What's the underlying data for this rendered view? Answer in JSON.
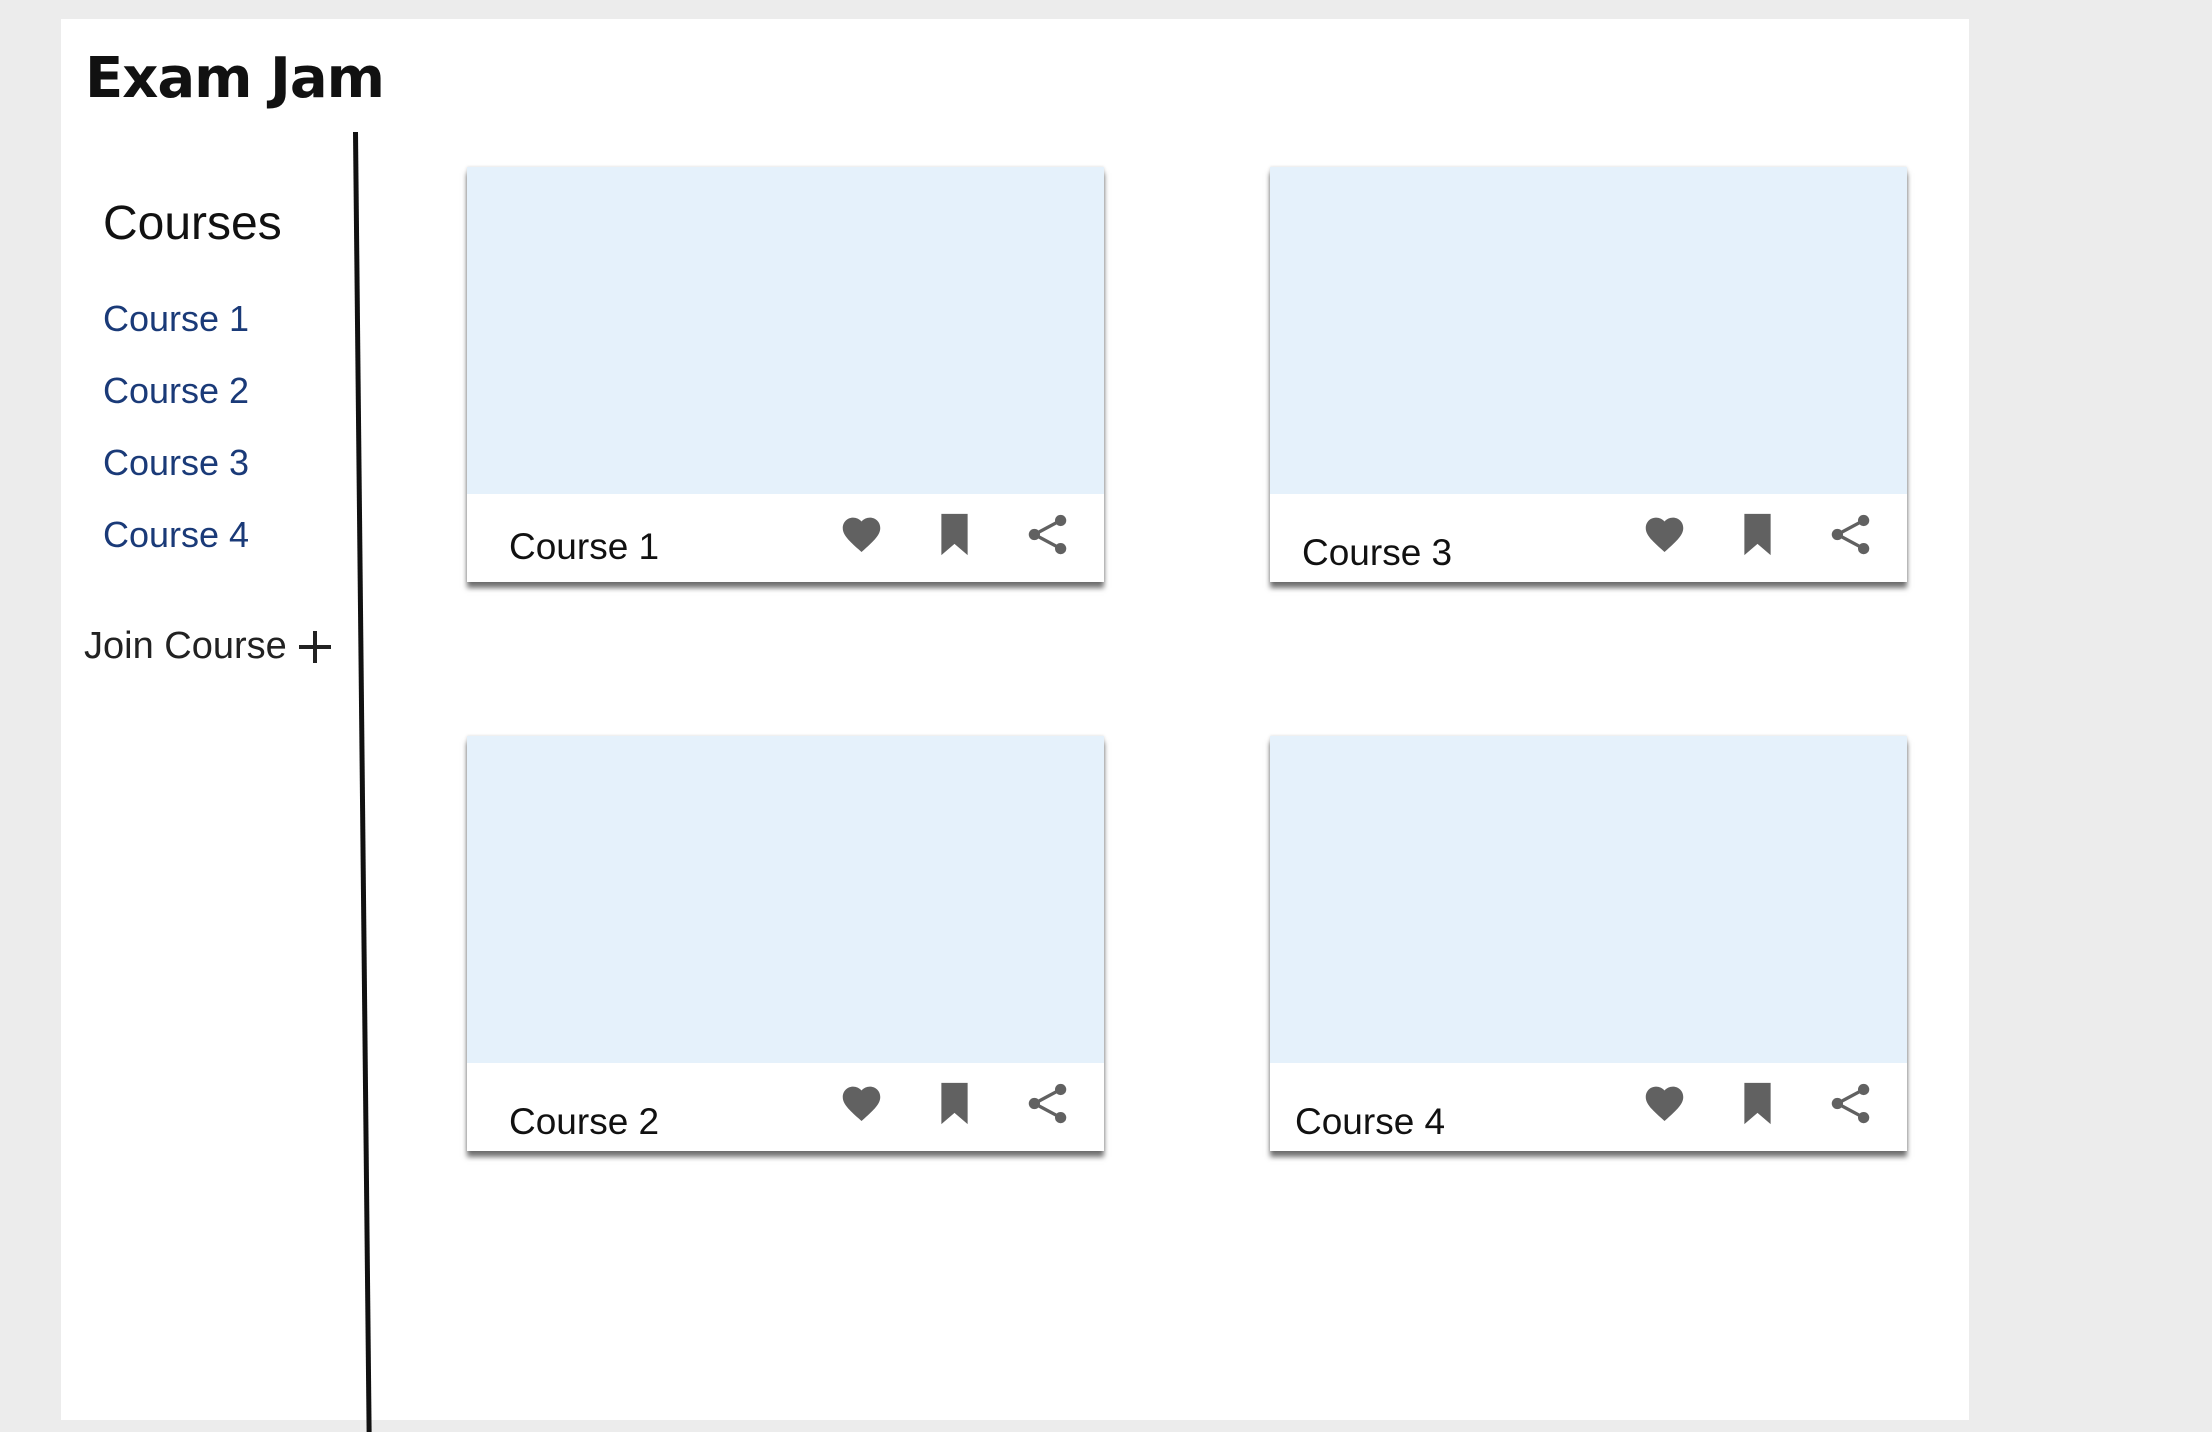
{
  "app": {
    "title": "Exam Jam"
  },
  "sidebar": {
    "heading": "Courses",
    "items": [
      {
        "label": "Course 1"
      },
      {
        "label": "Course 2"
      },
      {
        "label": "Course 3"
      },
      {
        "label": "Course 4"
      }
    ],
    "join_label": "Join Course",
    "join_icon": "plus-icon"
  },
  "cards": [
    {
      "title": "Course 1"
    },
    {
      "title": "Course 3"
    },
    {
      "title": "Course 2"
    },
    {
      "title": "Course 4"
    }
  ],
  "card_actions": [
    "heart-icon",
    "bookmark-icon",
    "share-icon"
  ],
  "colors": {
    "page_background": "#ececec",
    "card_media": "#e5f1fb",
    "link": "#1a3a78",
    "icon": "#616161"
  }
}
